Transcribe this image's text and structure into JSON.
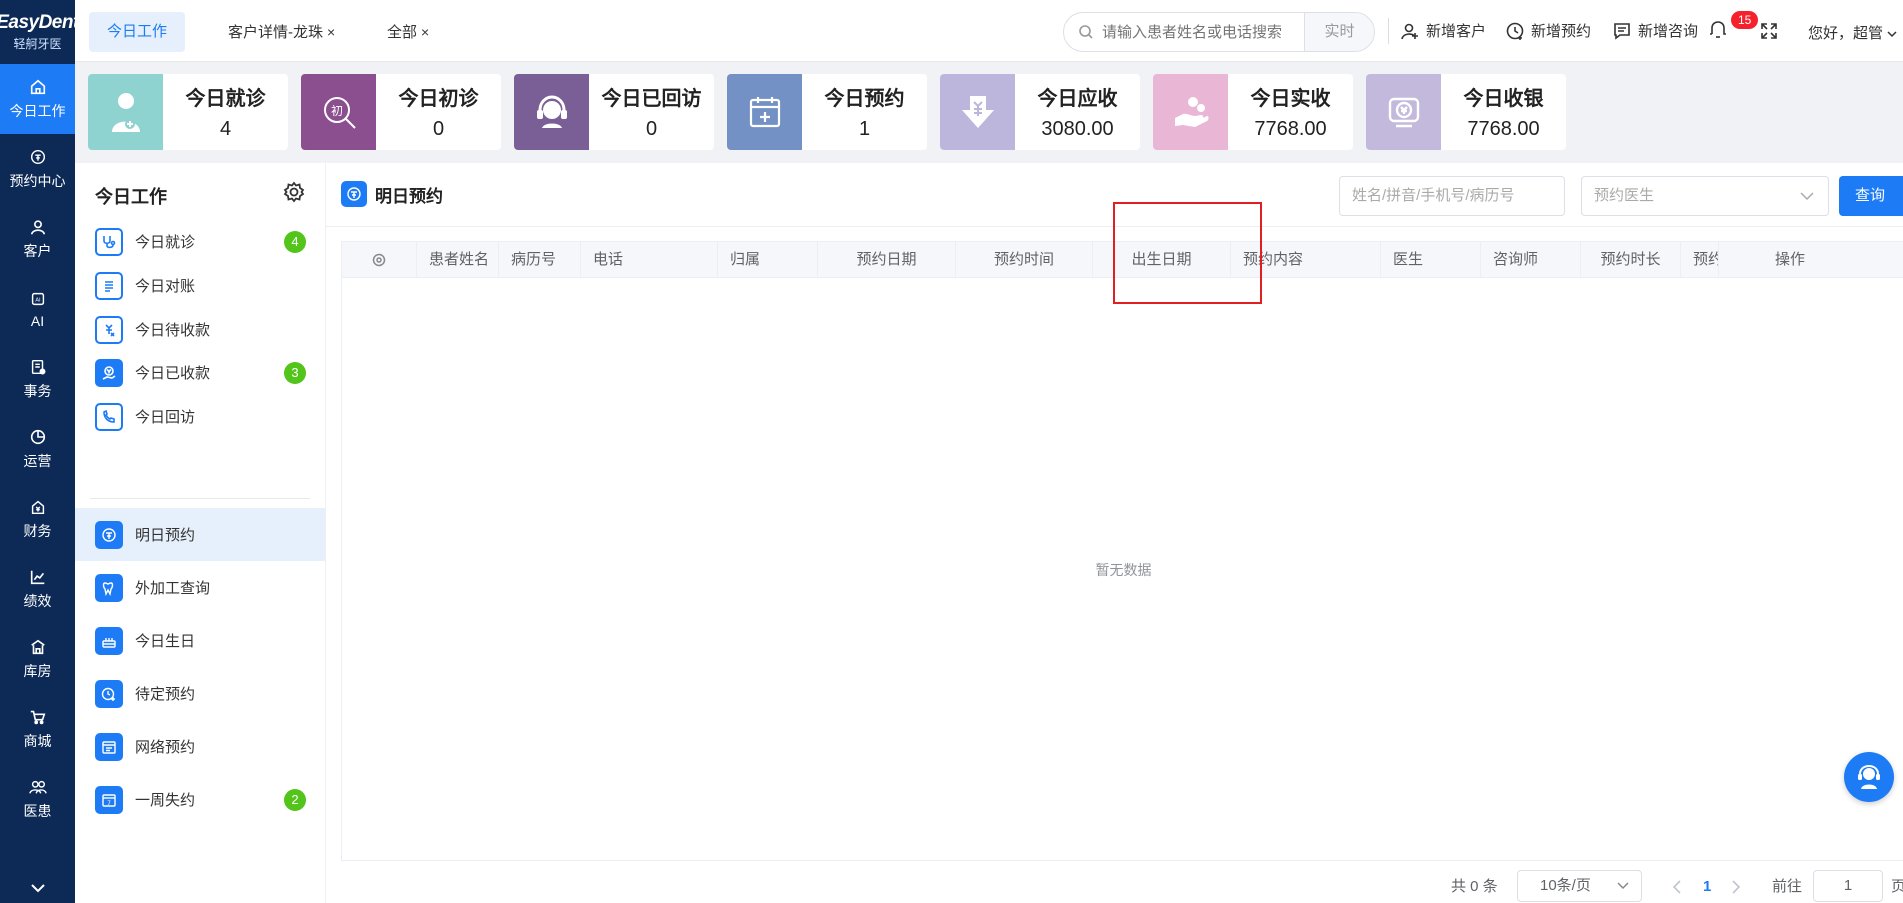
{
  "brand": {
    "name": "EasyDent",
    "sub": "轻舸牙医"
  },
  "nav": [
    {
      "label": "今日工作",
      "icon": "home-icon",
      "active": true
    },
    {
      "label": "预约中心",
      "icon": "appointment-icon"
    },
    {
      "label": "客户",
      "icon": "user-icon"
    },
    {
      "label": "AI",
      "icon": "ai-chip-icon"
    },
    {
      "label": "事务",
      "icon": "task-icon"
    },
    {
      "label": "运营",
      "icon": "pie-icon"
    },
    {
      "label": "财务",
      "icon": "finance-icon"
    },
    {
      "label": "绩效",
      "icon": "trend-icon"
    },
    {
      "label": "库房",
      "icon": "warehouse-icon"
    },
    {
      "label": "商城",
      "icon": "cart-icon"
    },
    {
      "label": "医患",
      "icon": "people-icon"
    }
  ],
  "tabs": [
    {
      "label": "今日工作",
      "active": true
    },
    {
      "label": "客户详情-龙珠",
      "close": "×"
    },
    {
      "label": "全部",
      "close": "×"
    }
  ],
  "search": {
    "placeholder": "请输入患者姓名或电话搜索",
    "realtime": "实时"
  },
  "top_actions": [
    {
      "label": "新增客户",
      "icon": "add-user-icon"
    },
    {
      "label": "新增预约",
      "icon": "add-appointment-icon"
    },
    {
      "label": "新增咨询",
      "icon": "chat-icon"
    }
  ],
  "notifications": "15",
  "greeting": "您好，超管",
  "stats": [
    {
      "title": "今日就诊",
      "value": "4",
      "color": "#8fd3d1",
      "icon": "doctor-icon"
    },
    {
      "title": "今日初诊",
      "value": "0",
      "color": "#8b4f8f",
      "icon": "first-visit-icon"
    },
    {
      "title": "今日已回访",
      "value": "0",
      "color": "#7a5f96",
      "icon": "headset-icon"
    },
    {
      "title": "今日预约",
      "value": "1",
      "color": "#7391c4",
      "icon": "calendar-icon"
    },
    {
      "title": "今日应收",
      "value": "3080.00",
      "color": "#bdb6dc",
      "icon": "receivable-icon"
    },
    {
      "title": "今日实收",
      "value": "7768.00",
      "color": "#e9b6d5",
      "icon": "received-icon"
    },
    {
      "title": "今日收银",
      "value": "7768.00",
      "color": "#c3b9dd",
      "icon": "cashier-icon"
    }
  ],
  "side": {
    "title": "今日工作",
    "items": [
      {
        "label": "今日就诊",
        "count": "4",
        "icon": "stethoscope-icon"
      },
      {
        "label": "今日对账",
        "count": "",
        "icon": "ledger-icon"
      },
      {
        "label": "今日待收款",
        "count": "",
        "icon": "pending-payment-icon"
      },
      {
        "label": "今日已收款",
        "count": "3",
        "icon": "paid-icon"
      },
      {
        "label": "今日回访",
        "count": "",
        "icon": "phone-icon"
      },
      {
        "label": "明日预约",
        "count": "",
        "icon": "appointment-icon",
        "active": true
      },
      {
        "label": "外加工查询",
        "count": "",
        "icon": "tooth-icon"
      },
      {
        "label": "今日生日",
        "count": "",
        "icon": "cake-icon"
      },
      {
        "label": "待定预约",
        "count": "",
        "icon": "clock-add-icon"
      },
      {
        "label": "网络预约",
        "count": "",
        "icon": "web-calendar-icon"
      },
      {
        "label": "一周失约",
        "count": "2",
        "icon": "week-calendar-icon"
      }
    ]
  },
  "main": {
    "title": "明日预约",
    "filter_placeholder": "姓名/拼音/手机号/病历号",
    "doctor_placeholder": "预约医生",
    "query": "查询",
    "columns": [
      "患者姓名",
      "病历号",
      "电话",
      "归属",
      "预约日期",
      "预约时间",
      "出生日期",
      "预约内容",
      "医生",
      "咨询师",
      "预约时长",
      "预约",
      "操作"
    ],
    "empty": "暂无数据"
  },
  "pagination": {
    "total": "共 0 条",
    "page_size": "10条/页",
    "current": "1",
    "goto_label": "前往",
    "goto_value": "1",
    "page_suffix": "页"
  },
  "colors": {
    "accent": "#1d7bf5",
    "nav_bg": "#0d2a56",
    "count_badge": "#52c41a",
    "highlight": "#e02020"
  }
}
